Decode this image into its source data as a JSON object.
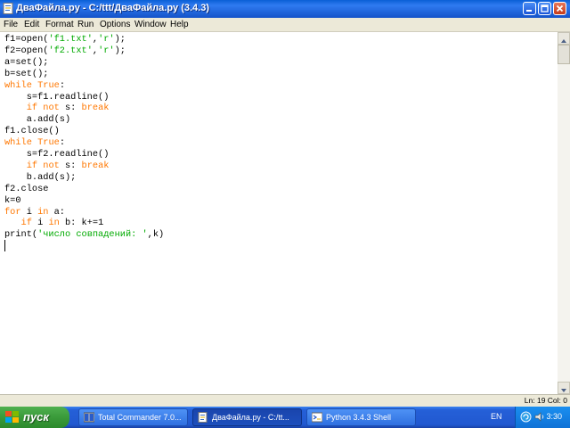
{
  "window": {
    "title": "ДваФайла.py - C:/ttt/ДваФайла.py (3.4.3)",
    "icon": "python-file-icon"
  },
  "menu": [
    "File",
    "Edit",
    "Format",
    "Run",
    "Options",
    "Window",
    "Help"
  ],
  "editor": {
    "lines": [
      [
        [
          "plain",
          "f1=open("
        ],
        [
          "str",
          "'f1.txt'"
        ],
        [
          "plain",
          ","
        ],
        [
          "str",
          "'r'"
        ],
        [
          "plain",
          ");"
        ]
      ],
      [
        [
          "plain",
          "f2=open("
        ],
        [
          "str",
          "'f2.txt'"
        ],
        [
          "plain",
          ","
        ],
        [
          "str",
          "'r'"
        ],
        [
          "plain",
          ");"
        ]
      ],
      [
        [
          "plain",
          "a=set();"
        ]
      ],
      [
        [
          "plain",
          "b=set();"
        ]
      ],
      [
        [
          "kw",
          "while"
        ],
        [
          "plain",
          " "
        ],
        [
          "kw",
          "True"
        ],
        [
          "plain",
          ":"
        ]
      ],
      [
        [
          "plain",
          "    s=f1.readline()"
        ]
      ],
      [
        [
          "plain",
          "    "
        ],
        [
          "kw",
          "if"
        ],
        [
          "plain",
          " "
        ],
        [
          "kw",
          "not"
        ],
        [
          "plain",
          " s: "
        ],
        [
          "kw",
          "break"
        ]
      ],
      [
        [
          "plain",
          "    a.add(s)"
        ]
      ],
      [
        [
          "plain",
          "f1.close()"
        ]
      ],
      [
        [
          "kw",
          "while"
        ],
        [
          "plain",
          " "
        ],
        [
          "kw",
          "True"
        ],
        [
          "plain",
          ":"
        ]
      ],
      [
        [
          "plain",
          "    s=f2.readline()"
        ]
      ],
      [
        [
          "plain",
          "    "
        ],
        [
          "kw",
          "if"
        ],
        [
          "plain",
          " "
        ],
        [
          "kw",
          "not"
        ],
        [
          "plain",
          " s: "
        ],
        [
          "kw",
          "break"
        ]
      ],
      [
        [
          "plain",
          "    b.add(s);"
        ]
      ],
      [
        [
          "plain",
          "f2.close"
        ]
      ],
      [
        [
          "plain",
          "k=0"
        ]
      ],
      [
        [
          "kw",
          "for"
        ],
        [
          "plain",
          " i "
        ],
        [
          "kw",
          "in"
        ],
        [
          "plain",
          " a:"
        ]
      ],
      [
        [
          "plain",
          "   "
        ],
        [
          "kw",
          "if"
        ],
        [
          "plain",
          " i "
        ],
        [
          "kw",
          "in"
        ],
        [
          "plain",
          " b: k+=1"
        ]
      ],
      [
        [
          "plain",
          "print("
        ],
        [
          "str",
          "'число совпадений: '"
        ],
        [
          "plain",
          ",k)"
        ]
      ]
    ]
  },
  "colors": {
    "keyword": "#ff7700",
    "string": "#00aa00",
    "plain": "#000000"
  },
  "status": {
    "position": "Ln: 19 Col: 0"
  },
  "taskbar": {
    "start_label": "пуск",
    "tasks": [
      {
        "label": "Total Commander 7.0...",
        "icon": "total-commander-icon",
        "active": false
      },
      {
        "label": "ДваФайла.py - C:/tt...",
        "icon": "python-file-icon",
        "active": true
      },
      {
        "label": "Python 3.4.3 Shell",
        "icon": "python-shell-icon",
        "active": false
      }
    ],
    "language": "EN",
    "clock": "3:30"
  }
}
